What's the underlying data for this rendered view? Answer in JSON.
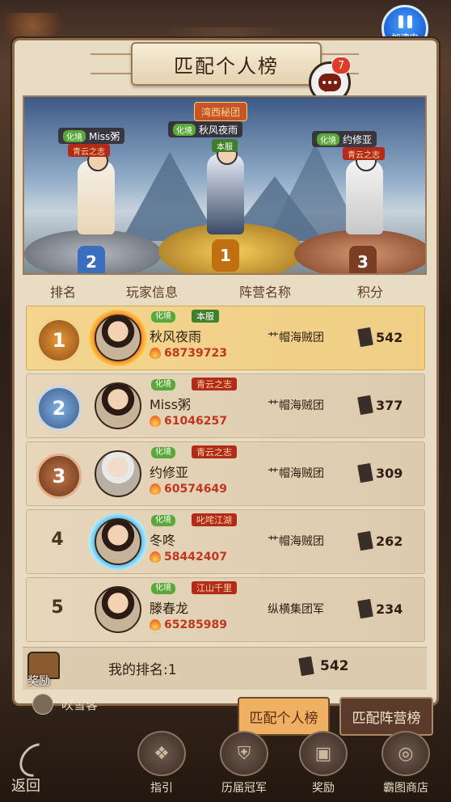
{
  "speed_button": {
    "label": "加速中"
  },
  "title": "匹配个人榜",
  "chat": {
    "badge_count": "7"
  },
  "podium": {
    "guild_banner": "湾西秘团",
    "players": [
      {
        "rank": "2",
        "name": "Miss粥",
        "realm": "化境",
        "server": "青云之志"
      },
      {
        "rank": "1",
        "name": "秋风夜雨",
        "realm": "化境",
        "server": "本服"
      },
      {
        "rank": "3",
        "name": "约修亚",
        "realm": "化境",
        "server": "青云之志"
      }
    ]
  },
  "columns": {
    "rank": "排名",
    "player": "玩家信息",
    "faction": "阵营名称",
    "score": "积分"
  },
  "rows": [
    {
      "rank": "1",
      "realm": "化境",
      "server": "本服",
      "name": "秋风夜雨",
      "power": "68739723",
      "faction": "艹帽海贼团",
      "score": "542"
    },
    {
      "rank": "2",
      "realm": "化境",
      "server": "青云之志",
      "name": "Miss粥",
      "power": "61046257",
      "faction": "艹帽海贼团",
      "score": "377"
    },
    {
      "rank": "3",
      "realm": "化境",
      "server": "青云之志",
      "name": "约修亚",
      "power": "60574649",
      "faction": "艹帽海贼团",
      "score": "309"
    },
    {
      "rank": "4",
      "realm": "化境",
      "server": "叱咤江湖",
      "name": "冬咚",
      "power": "58442407",
      "faction": "艹帽海贼团",
      "score": "262"
    },
    {
      "rank": "5",
      "realm": "化境",
      "server": "江山千里",
      "name": "滕春龙",
      "power": "65285989",
      "faction": "纵横集团军",
      "score": "234"
    }
  ],
  "my_rank": {
    "reward_label": "奖励",
    "label": "我的排名:1",
    "score": "542"
  },
  "tabs": {
    "personal": "匹配个人榜",
    "faction": "匹配阵营榜"
  },
  "behind_row": {
    "name": "吹雪客"
  },
  "nav": {
    "back": "返回",
    "guide": "指引",
    "champions": "历届冠军",
    "reward": "奖励",
    "shop": "霸图商店"
  },
  "colors": {
    "gold_row": "#f0cf85",
    "panel": "#e9dcc4",
    "power_red": "#c2361c",
    "accent_blue": "#1a5fd6"
  }
}
